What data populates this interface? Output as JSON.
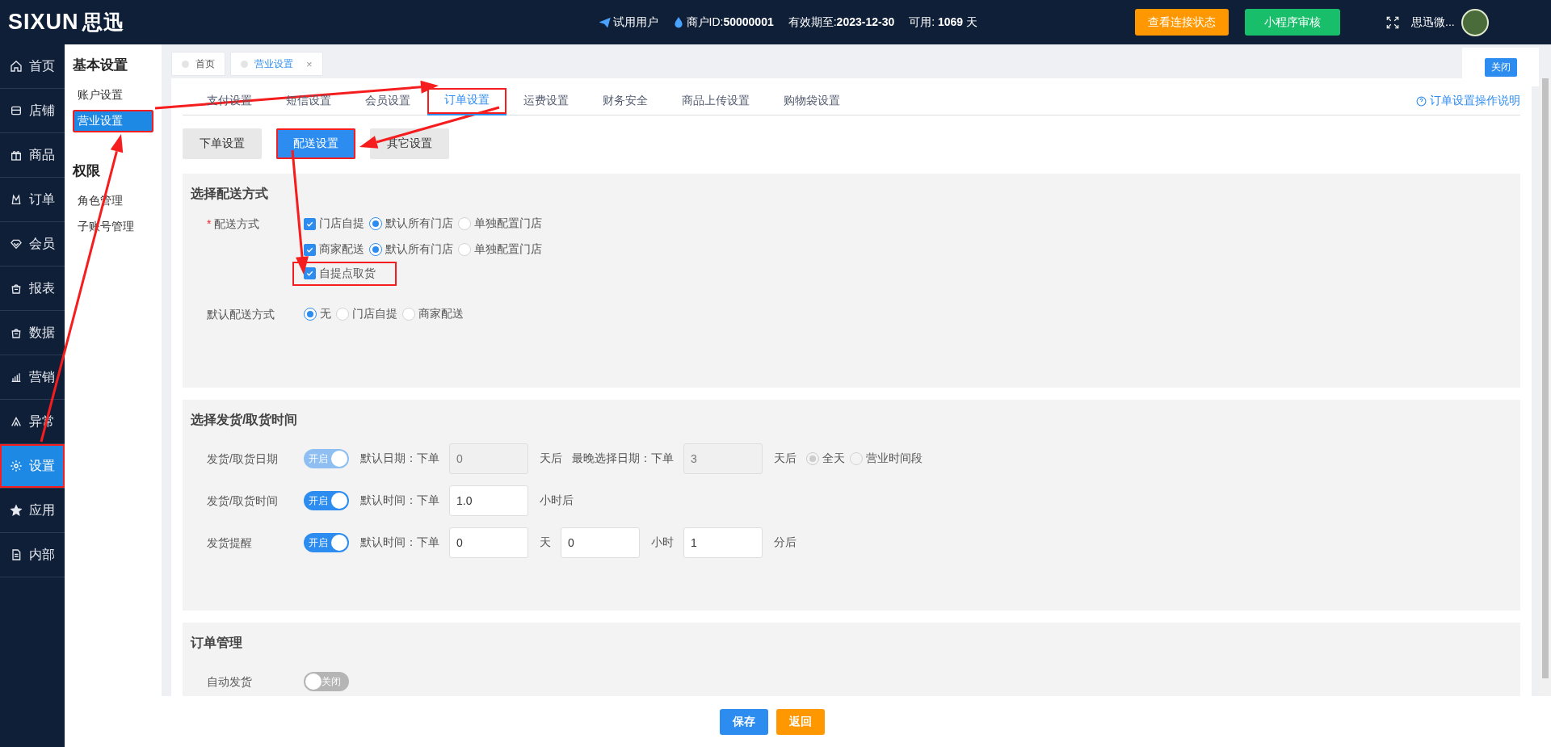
{
  "header": {
    "logo": "SIXUN",
    "logo_cn": "思迅",
    "account_type": "试用用户",
    "merchant_id_label": "商户ID:",
    "merchant_id": "50000001",
    "expiry_label": "有效期至:",
    "expiry": "2023-12-30",
    "available_label": "可用:",
    "available_days": "1069",
    "available_unit": "天",
    "buttons": [
      {
        "label": "查看连接状态",
        "kind": "warning"
      },
      {
        "label": "小程序审核",
        "kind": "success"
      }
    ],
    "user_name": "思迅微..."
  },
  "sidebar": {
    "items": [
      {
        "label": "首页",
        "selected": false,
        "highlighted": false
      },
      {
        "label": "店铺",
        "selected": false,
        "highlighted": false
      },
      {
        "label": "商品",
        "selected": false,
        "highlighted": false
      },
      {
        "label": "订单",
        "selected": false,
        "highlighted": false
      },
      {
        "label": "会员",
        "selected": false,
        "highlighted": false
      },
      {
        "label": "报表",
        "selected": false,
        "highlighted": false
      },
      {
        "label": "数据",
        "selected": false,
        "highlighted": false
      },
      {
        "label": "营销",
        "selected": false,
        "highlighted": false
      },
      {
        "label": "异常",
        "selected": false,
        "highlighted": false
      },
      {
        "label": "设置",
        "selected": true,
        "highlighted": true
      },
      {
        "label": "应用",
        "selected": false,
        "highlighted": false
      },
      {
        "label": "内部",
        "selected": false,
        "highlighted": false
      }
    ]
  },
  "subnav": {
    "groups": [
      {
        "title": "基本设置",
        "items": [
          {
            "label": "账户设置",
            "selected": false,
            "highlighted": false
          },
          {
            "label": "营业设置",
            "selected": true,
            "highlighted": true
          }
        ]
      },
      {
        "title": "权限",
        "items": [
          {
            "label": "角色管理",
            "selected": false,
            "highlighted": false
          },
          {
            "label": "子账号管理",
            "selected": false,
            "highlighted": false
          }
        ]
      }
    ]
  },
  "page_tabs": {
    "items": [
      {
        "label": "首页",
        "selected": false
      },
      {
        "label": "营业设置",
        "selected": true,
        "close_icon": "×"
      }
    ],
    "close_button": "关闭"
  },
  "settings_tabs": {
    "items": [
      {
        "label": "支付设置",
        "selected": false,
        "highlighted": false
      },
      {
        "label": "短信设置",
        "selected": false,
        "highlighted": false
      },
      {
        "label": "会员设置",
        "selected": false,
        "highlighted": false
      },
      {
        "label": "订单设置",
        "selected": true,
        "highlighted": true
      },
      {
        "label": "运费设置",
        "selected": false,
        "highlighted": false
      },
      {
        "label": "财务安全",
        "selected": false,
        "highlighted": false
      },
      {
        "label": "商品上传设置",
        "selected": false,
        "highlighted": false
      },
      {
        "label": "购物袋设置",
        "selected": false,
        "highlighted": false
      }
    ],
    "help_link": "订单设置操作说明"
  },
  "sub_tabs": [
    {
      "label": "下单设置",
      "selected": false,
      "highlighted": false
    },
    {
      "label": "配送设置",
      "selected": true,
      "highlighted": true
    },
    {
      "label": "其它设置",
      "selected": false,
      "highlighted": false
    }
  ],
  "delivery_section": {
    "title": "选择配送方式",
    "method_label": "配送方式",
    "required_mark": "*",
    "method_rows": [
      {
        "kind": "check_radio",
        "label": "门店自提",
        "checked": true,
        "highlighted": false,
        "radios": [
          {
            "label": "默认所有门店",
            "selected": true
          },
          {
            "label": "单独配置门店",
            "selected": false
          }
        ]
      },
      {
        "kind": "check_radio",
        "label": "商家配送",
        "checked": true,
        "highlighted": false,
        "radios": [
          {
            "label": "默认所有门店",
            "selected": true
          },
          {
            "label": "单独配置门店",
            "selected": false
          }
        ]
      },
      {
        "kind": "check",
        "label": "自提点取货",
        "checked": true,
        "highlighted": true
      }
    ],
    "default_label": "默认配送方式",
    "default_options": [
      {
        "label": "无",
        "selected": true
      },
      {
        "label": "门店自提",
        "selected": false
      },
      {
        "label": "商家配送",
        "selected": false
      }
    ]
  },
  "time_section": {
    "title": "选择发货/取货时间",
    "rows": [
      {
        "label": "发货/取货日期",
        "toggle": {
          "text": "开启",
          "on": true,
          "disabled": true
        },
        "items": [
          {
            "kind": "text",
            "text": "默认日期：下单"
          },
          {
            "kind": "input",
            "value": "0",
            "disabled": true
          },
          {
            "kind": "text",
            "text": "天后"
          },
          {
            "kind": "text",
            "text": "最晚选择日期：下单"
          },
          {
            "kind": "input",
            "value": "3",
            "disabled": true
          },
          {
            "kind": "text",
            "text": "天后"
          },
          {
            "kind": "radio",
            "text": "全天",
            "selected": true,
            "disabled": true
          },
          {
            "kind": "radio",
            "text": "营业时间段",
            "selected": false,
            "disabled": true
          }
        ]
      },
      {
        "label": "发货/取货时间",
        "toggle": {
          "text": "开启",
          "on": true,
          "disabled": false
        },
        "items": [
          {
            "kind": "text",
            "text": "默认时间：下单"
          },
          {
            "kind": "input",
            "value": "1.0",
            "disabled": false
          },
          {
            "kind": "text",
            "text": "小时后"
          }
        ]
      },
      {
        "label": "发货提醒",
        "toggle": {
          "text": "开启",
          "on": true,
          "disabled": false
        },
        "items": [
          {
            "kind": "text",
            "text": "默认时间：下单"
          },
          {
            "kind": "input",
            "value": "0",
            "disabled": false
          },
          {
            "kind": "text",
            "text": "天"
          },
          {
            "kind": "input",
            "value": "0",
            "disabled": false
          },
          {
            "kind": "text",
            "text": "小时"
          },
          {
            "kind": "input",
            "value": "1",
            "disabled": false
          },
          {
            "kind": "text",
            "text": "分后"
          }
        ]
      }
    ]
  },
  "order_section": {
    "title": "订单管理",
    "rows": [
      {
        "label": "自动发货",
        "toggle": {
          "text": "关闭",
          "on": false,
          "disabled": true
        },
        "items": []
      }
    ]
  },
  "footer": {
    "buttons": [
      {
        "label": "保存",
        "kind": "primary"
      },
      {
        "label": "返回",
        "kind": "warning"
      }
    ]
  }
}
